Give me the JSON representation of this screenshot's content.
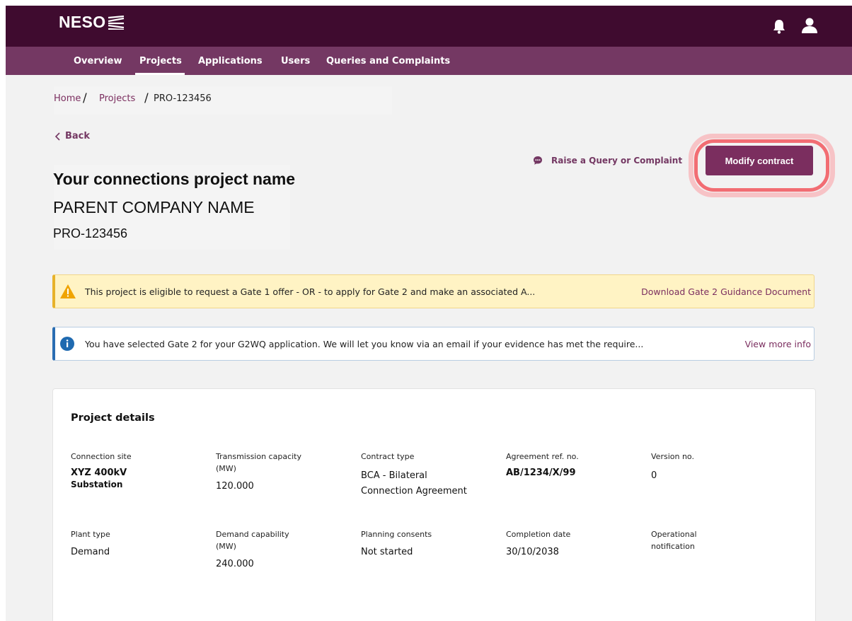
{
  "header": {
    "logo_text": "NESO",
    "icons": [
      "notification-bell-icon",
      "user-account-icon"
    ]
  },
  "nav": {
    "items": [
      {
        "label": "Overview"
      },
      {
        "label": "Projects"
      },
      {
        "label": "Applications"
      },
      {
        "label": "Users"
      },
      {
        "label": "Queries and Complaints"
      }
    ],
    "active": "Projects"
  },
  "breadcrumb": {
    "home": "Home",
    "projects": "Projects",
    "current": "PRO-123456",
    "separator": "/"
  },
  "back_label": "Back",
  "actions": {
    "raise_query": "Raise a Query or Complaint",
    "modify_contract": "Modify contract"
  },
  "project": {
    "title": "Your connections project name",
    "company": "PARENT COMPANY NAME",
    "id": "PRO-123456"
  },
  "alerts": {
    "warning": {
      "message": "This project is eligible to request a Gate 1 offer - OR - to apply for Gate 2 and make an associated A...",
      "action": "Download Gate 2 Guidance Document"
    },
    "info": {
      "message": "You have selected Gate 2 for your G2WQ application. We will let you know via an email if your evidence has met the require...",
      "action": "View more info"
    }
  },
  "details": {
    "title": "Project details",
    "fields": {
      "connection_site": {
        "label": "Connection site",
        "value_line1": "XYZ 400kV",
        "value_line2": "Substation"
      },
      "transmission_capacity": {
        "label_line1": "Transmission capacity",
        "label_line2": "(MW)",
        "value": "120.000"
      },
      "contract_type": {
        "label": "Contract type",
        "value_line1": "BCA - Bilateral",
        "value_line2": "Connection Agreement"
      },
      "agreement_ref": {
        "label": "Agreement ref. no.",
        "value": "AB/1234/X/99"
      },
      "version": {
        "label": "Version no.",
        "value": "0"
      },
      "plant_type": {
        "label": "Plant type",
        "value": "Demand"
      },
      "demand_capability": {
        "label_line1": "Demand capability",
        "label_line2": "(MW)",
        "value": "240.000"
      },
      "planning_consents": {
        "label": "Planning consents",
        "value": "Not started"
      },
      "completion_date": {
        "label": "Completion date",
        "value": "30/10/2038"
      },
      "operational_notification": {
        "label_line1": "Operational",
        "label_line2": "notification"
      }
    }
  }
}
